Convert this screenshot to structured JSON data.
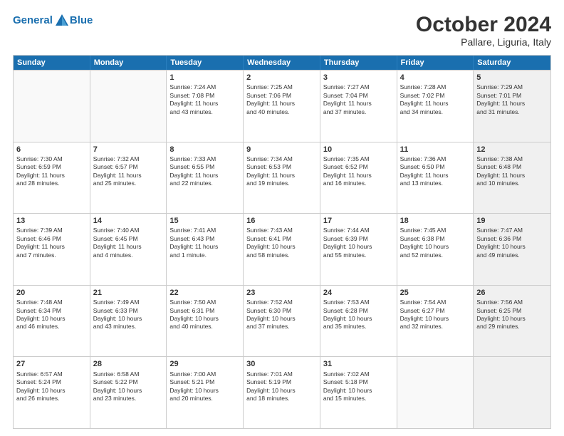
{
  "header": {
    "logo_line1": "General",
    "logo_line2": "Blue",
    "month": "October 2024",
    "location": "Pallare, Liguria, Italy"
  },
  "weekdays": [
    "Sunday",
    "Monday",
    "Tuesday",
    "Wednesday",
    "Thursday",
    "Friday",
    "Saturday"
  ],
  "weeks": [
    [
      {
        "day": "",
        "info": "",
        "empty": true
      },
      {
        "day": "",
        "info": "",
        "empty": true
      },
      {
        "day": "1",
        "info": "Sunrise: 7:24 AM\nSunset: 7:08 PM\nDaylight: 11 hours\nand 43 minutes."
      },
      {
        "day": "2",
        "info": "Sunrise: 7:25 AM\nSunset: 7:06 PM\nDaylight: 11 hours\nand 40 minutes."
      },
      {
        "day": "3",
        "info": "Sunrise: 7:27 AM\nSunset: 7:04 PM\nDaylight: 11 hours\nand 37 minutes."
      },
      {
        "day": "4",
        "info": "Sunrise: 7:28 AM\nSunset: 7:02 PM\nDaylight: 11 hours\nand 34 minutes."
      },
      {
        "day": "5",
        "info": "Sunrise: 7:29 AM\nSunset: 7:01 PM\nDaylight: 11 hours\nand 31 minutes.",
        "shaded": true
      }
    ],
    [
      {
        "day": "6",
        "info": "Sunrise: 7:30 AM\nSunset: 6:59 PM\nDaylight: 11 hours\nand 28 minutes."
      },
      {
        "day": "7",
        "info": "Sunrise: 7:32 AM\nSunset: 6:57 PM\nDaylight: 11 hours\nand 25 minutes."
      },
      {
        "day": "8",
        "info": "Sunrise: 7:33 AM\nSunset: 6:55 PM\nDaylight: 11 hours\nand 22 minutes."
      },
      {
        "day": "9",
        "info": "Sunrise: 7:34 AM\nSunset: 6:53 PM\nDaylight: 11 hours\nand 19 minutes."
      },
      {
        "day": "10",
        "info": "Sunrise: 7:35 AM\nSunset: 6:52 PM\nDaylight: 11 hours\nand 16 minutes."
      },
      {
        "day": "11",
        "info": "Sunrise: 7:36 AM\nSunset: 6:50 PM\nDaylight: 11 hours\nand 13 minutes."
      },
      {
        "day": "12",
        "info": "Sunrise: 7:38 AM\nSunset: 6:48 PM\nDaylight: 11 hours\nand 10 minutes.",
        "shaded": true
      }
    ],
    [
      {
        "day": "13",
        "info": "Sunrise: 7:39 AM\nSunset: 6:46 PM\nDaylight: 11 hours\nand 7 minutes."
      },
      {
        "day": "14",
        "info": "Sunrise: 7:40 AM\nSunset: 6:45 PM\nDaylight: 11 hours\nand 4 minutes."
      },
      {
        "day": "15",
        "info": "Sunrise: 7:41 AM\nSunset: 6:43 PM\nDaylight: 11 hours\nand 1 minute."
      },
      {
        "day": "16",
        "info": "Sunrise: 7:43 AM\nSunset: 6:41 PM\nDaylight: 10 hours\nand 58 minutes."
      },
      {
        "day": "17",
        "info": "Sunrise: 7:44 AM\nSunset: 6:39 PM\nDaylight: 10 hours\nand 55 minutes."
      },
      {
        "day": "18",
        "info": "Sunrise: 7:45 AM\nSunset: 6:38 PM\nDaylight: 10 hours\nand 52 minutes."
      },
      {
        "day": "19",
        "info": "Sunrise: 7:47 AM\nSunset: 6:36 PM\nDaylight: 10 hours\nand 49 minutes.",
        "shaded": true
      }
    ],
    [
      {
        "day": "20",
        "info": "Sunrise: 7:48 AM\nSunset: 6:34 PM\nDaylight: 10 hours\nand 46 minutes."
      },
      {
        "day": "21",
        "info": "Sunrise: 7:49 AM\nSunset: 6:33 PM\nDaylight: 10 hours\nand 43 minutes."
      },
      {
        "day": "22",
        "info": "Sunrise: 7:50 AM\nSunset: 6:31 PM\nDaylight: 10 hours\nand 40 minutes."
      },
      {
        "day": "23",
        "info": "Sunrise: 7:52 AM\nSunset: 6:30 PM\nDaylight: 10 hours\nand 37 minutes."
      },
      {
        "day": "24",
        "info": "Sunrise: 7:53 AM\nSunset: 6:28 PM\nDaylight: 10 hours\nand 35 minutes."
      },
      {
        "day": "25",
        "info": "Sunrise: 7:54 AM\nSunset: 6:27 PM\nDaylight: 10 hours\nand 32 minutes."
      },
      {
        "day": "26",
        "info": "Sunrise: 7:56 AM\nSunset: 6:25 PM\nDaylight: 10 hours\nand 29 minutes.",
        "shaded": true
      }
    ],
    [
      {
        "day": "27",
        "info": "Sunrise: 6:57 AM\nSunset: 5:24 PM\nDaylight: 10 hours\nand 26 minutes."
      },
      {
        "day": "28",
        "info": "Sunrise: 6:58 AM\nSunset: 5:22 PM\nDaylight: 10 hours\nand 23 minutes."
      },
      {
        "day": "29",
        "info": "Sunrise: 7:00 AM\nSunset: 5:21 PM\nDaylight: 10 hours\nand 20 minutes."
      },
      {
        "day": "30",
        "info": "Sunrise: 7:01 AM\nSunset: 5:19 PM\nDaylight: 10 hours\nand 18 minutes."
      },
      {
        "day": "31",
        "info": "Sunrise: 7:02 AM\nSunset: 5:18 PM\nDaylight: 10 hours\nand 15 minutes."
      },
      {
        "day": "",
        "info": "",
        "empty": true
      },
      {
        "day": "",
        "info": "",
        "empty": true,
        "shaded": true
      }
    ]
  ]
}
